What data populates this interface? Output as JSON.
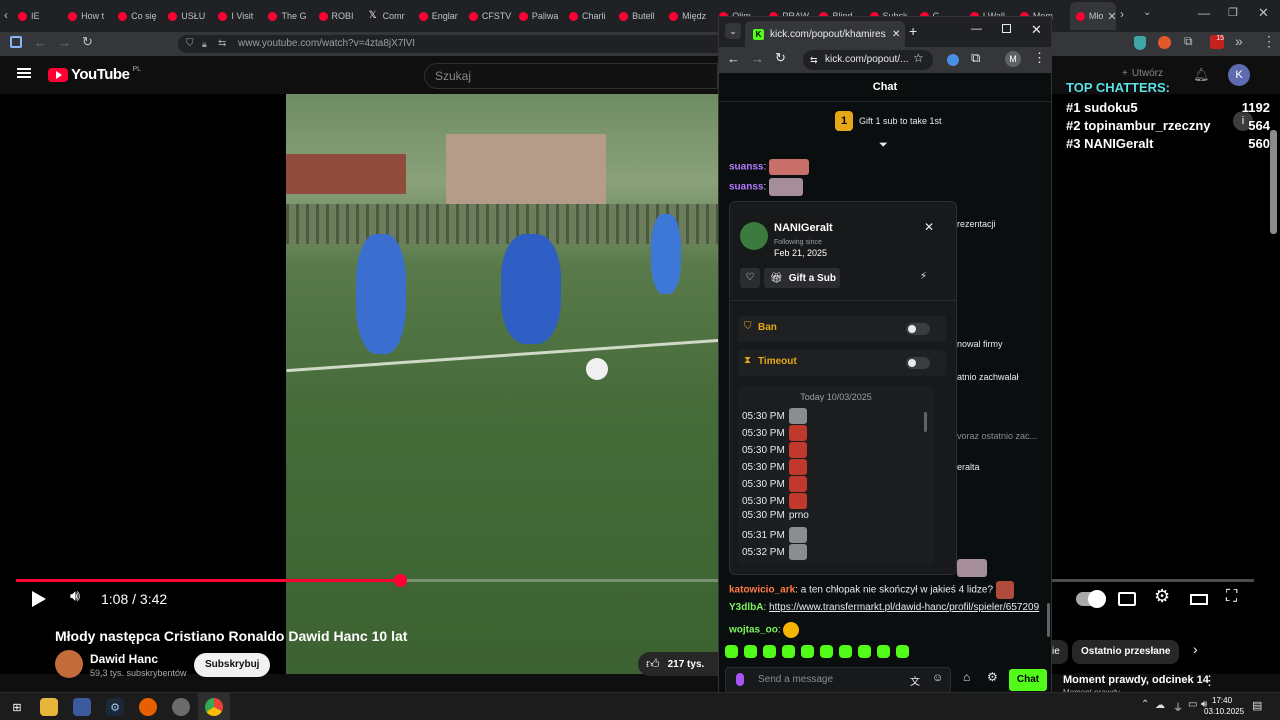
{
  "background_browser": {
    "tabs": [
      "IE",
      "How t",
      "Co się",
      "USŁU",
      "I Visit",
      "The G",
      "ROBI",
      "Comr",
      "Englar",
      "CFSTV",
      "Paliwa",
      "Charli",
      "Butell",
      "Międz",
      "Olim",
      "PRAW",
      "Blind",
      "Subsk",
      "G",
      "I Wall",
      "Mom",
      "Mło"
    ],
    "url": "www.youtube.com/watch?v=4zta8jX7lVI"
  },
  "youtube": {
    "logo_text": "YouTube",
    "region": "PL",
    "search_placeholder": "Szukaj",
    "time": "1:08 / 3:42",
    "progress_fraction": 0.31,
    "title": "Młody następca Cristiano Ronaldo Dawid Hanc 10 lat",
    "channel": "Dawid Hanc",
    "subscribers": "59,3 tys. subskrybentów",
    "subscribe_label": "Subskrybuj",
    "likes": "217 tys.",
    "create_label": "Utwórz",
    "avatar_letter": "K",
    "chip_recent": "Ostatnio przesłane",
    "chip_partial": "ie",
    "related_title": "Moment prawdy, odcinek 14",
    "related_sub": "Moment prawdy"
  },
  "overlay": {
    "heading": "TOP CHATTERS:",
    "rows": [
      {
        "rank": "#1",
        "name": "sudoku5",
        "count": "1192"
      },
      {
        "rank": "#2",
        "name": "topinambur_rzeczny",
        "count": "564"
      },
      {
        "rank": "#3",
        "name": "NANIGeralt",
        "count": "560"
      }
    ]
  },
  "kick_window": {
    "tab_title": "kick.com/popout/khamires/cha",
    "url": "kick.com/popout/...",
    "profile_letter": "M",
    "chat_header": "Chat",
    "gift_rank": "1",
    "gift_text": "Gift 1 sub to take 1st",
    "messages_top": [
      {
        "user": "suanss",
        "sep": ":"
      },
      {
        "user": "suanss",
        "sep": ":"
      }
    ],
    "partial_texts": [
      "rezentacji",
      "nowal firmy",
      "atnio zachwalał",
      "voraz ostatnio zac...",
      "eralta"
    ],
    "messages_bottom": [
      {
        "user": "katowicio_ark",
        "text": ": a ten chłopak nie skończył w jakieś 4 lidze?"
      },
      {
        "user": "Y3dlbA",
        "text": ": ",
        "link": "https://www.transfermarkt.pl/dawid-hanc/profil/spieler/657209"
      },
      {
        "user": "wojtas_oo",
        "text": ":"
      }
    ],
    "send_placeholder": "Send a message",
    "chat_button": "Chat",
    "colors": {
      "kick_green": "#53fc18",
      "user_purple": "#b57bff",
      "user_orange": "#ff7a45",
      "user_green": "#7cf35f",
      "link_blue": "#8ab4f8"
    }
  },
  "user_card": {
    "username": "NANIGeralt",
    "following_label": "Following since",
    "following_date": "Feb 21, 2025",
    "gift_sub_label": "Gift a Sub",
    "ban_label": "Ban",
    "timeout_label": "Timeout",
    "log_date": "Today 10/03/2025",
    "log": [
      {
        "time": "05:30 PM",
        "text": "",
        "emote": "gray"
      },
      {
        "time": "05:30 PM",
        "text": "",
        "emote": "red"
      },
      {
        "time": "05:30 PM",
        "text": "",
        "emote": "red"
      },
      {
        "time": "05:30 PM",
        "text": "",
        "emote": "red"
      },
      {
        "time": "05:30 PM",
        "text": "",
        "emote": "red"
      },
      {
        "time": "05:30 PM",
        "text": "",
        "emote": "red"
      },
      {
        "time": "05:30 PM",
        "text": "prno",
        "emote": "none"
      },
      {
        "time": "05:31 PM",
        "text": "",
        "emote": "gray"
      },
      {
        "time": "05:32 PM",
        "text": "",
        "emote": "gray"
      }
    ]
  },
  "taskbar": {
    "time": "17:40",
    "date": "03.10.2025"
  }
}
